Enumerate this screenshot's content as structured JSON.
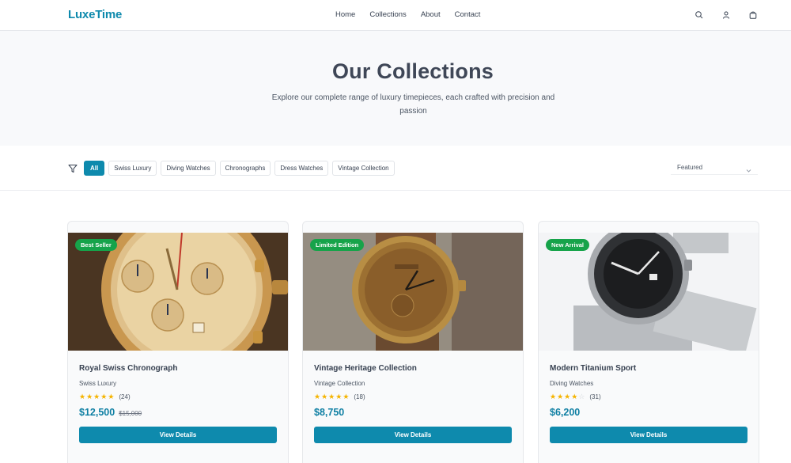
{
  "header": {
    "logo": "LuxeTime",
    "nav": [
      "Home",
      "Collections",
      "About",
      "Contact"
    ],
    "icons": [
      "search-icon",
      "user-icon",
      "cart-icon"
    ]
  },
  "hero": {
    "title": "Our Collections",
    "subtitle": "Explore our complete range of luxury timepieces, each crafted with precision and passion"
  },
  "filters": {
    "chips": [
      "All",
      "Swiss Luxury",
      "Diving Watches",
      "Chronographs",
      "Dress Watches",
      "Vintage Collection"
    ],
    "active": "All",
    "sort_label": "Featured"
  },
  "products": [
    {
      "badge": "Best Seller",
      "title": "Royal Swiss Chronograph",
      "category": "Swiss Luxury",
      "rating": 5,
      "reviews": "(24)",
      "price": "$12,500",
      "old_price": "$15,000",
      "button": "View Details"
    },
    {
      "badge": "Limited Edition",
      "title": "Vintage Heritage Collection",
      "category": "Vintage Collection",
      "rating": 5,
      "reviews": "(18)",
      "price": "$8,750",
      "old_price": "",
      "button": "View Details"
    },
    {
      "badge": "New Arrival",
      "title": "Modern Titanium Sport",
      "category": "Diving Watches",
      "rating": 4,
      "reviews": "(31)",
      "price": "$6,200",
      "old_price": "",
      "button": "View Details"
    }
  ],
  "colors": {
    "accent": "#0e8aad",
    "badge": "#16a34a",
    "star": "#f5b400"
  }
}
